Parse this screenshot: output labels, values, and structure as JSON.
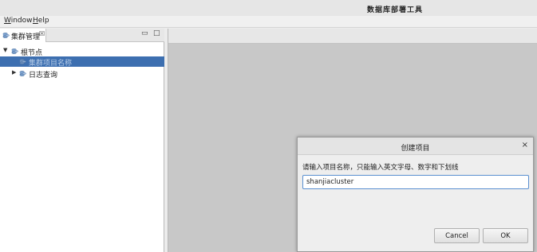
{
  "window": {
    "title": "数据库部署工具"
  },
  "menu": {
    "window_label": "Window",
    "window_mnemonic": "W",
    "window_rest": "indow",
    "help_label": "Help",
    "help_mnemonic": "H",
    "help_rest": "elp"
  },
  "panel": {
    "tab_label": "集群管理",
    "tab_close": "☒",
    "minimize": "▭",
    "maximize": "□"
  },
  "tree": {
    "root": {
      "label": "根节点",
      "expanded": true
    },
    "items": [
      {
        "label": "集群项目名称",
        "selected": true
      },
      {
        "label": "日志查询",
        "expanded": false
      }
    ]
  },
  "dialog": {
    "title": "创建项目",
    "close": "×",
    "prompt": "请输入项目名称，只能输入英文字母、数字和下划线",
    "input_value": "shanjiacluster",
    "cancel_label": "Cancel",
    "ok_label": "OK"
  },
  "colors": {
    "selection": "#3d6fb0",
    "focus_border": "#5a8fd0"
  }
}
